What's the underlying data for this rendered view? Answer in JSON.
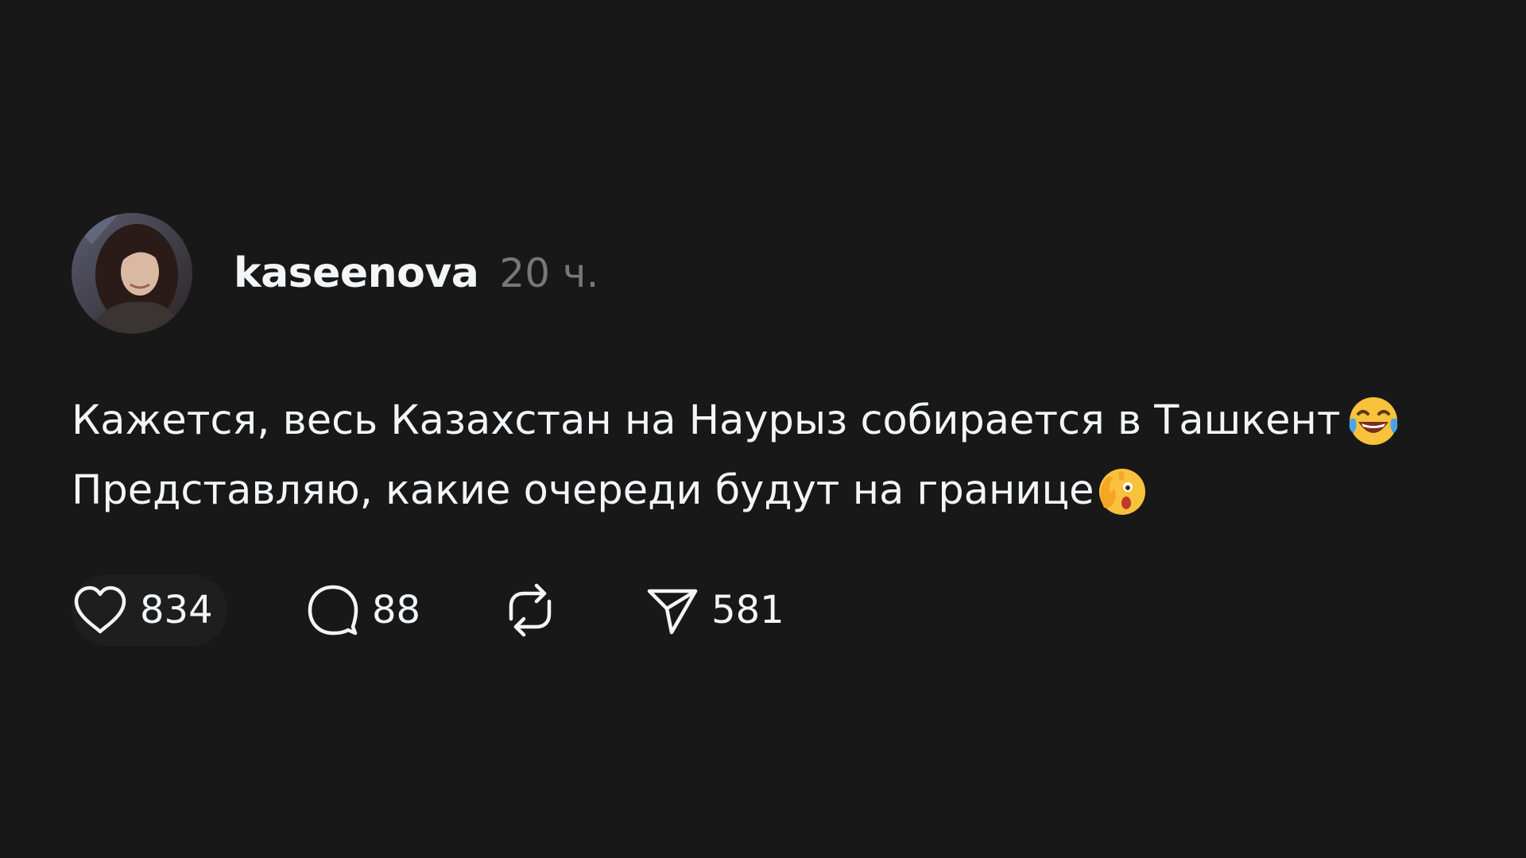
{
  "post": {
    "author": {
      "username": "kaseenova",
      "avatar_icon": "profile-photo"
    },
    "timestamp": "20 ч.",
    "text_lines": [
      "Кажется, весь Казахстан на Наурыз собирается в Ташкент ",
      "Представляю, какие очереди будут на границе"
    ],
    "emojis": [
      "face-with-tears-of-joy-emoji",
      "shocked-face-with-hands-emoji"
    ],
    "actions": {
      "like": {
        "icon": "heart-icon",
        "count": "834"
      },
      "reply": {
        "icon": "comment-icon",
        "count": "88"
      },
      "repost": {
        "icon": "repost-icon"
      },
      "share": {
        "icon": "send-icon",
        "count": "581"
      }
    }
  },
  "colors": {
    "background": "#181818",
    "text": "#f3f5f7",
    "muted": "#777777"
  }
}
